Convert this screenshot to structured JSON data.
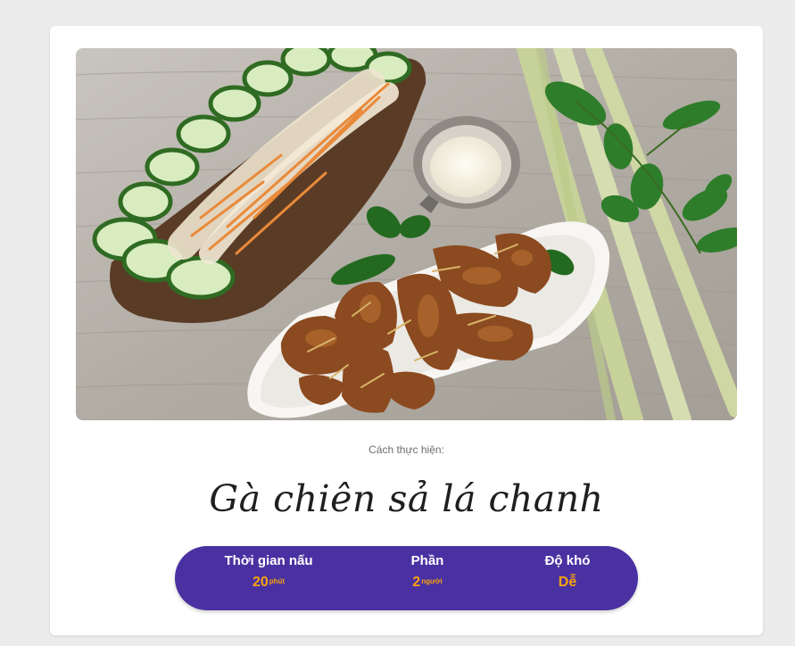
{
  "recipe": {
    "subtitle": "Cách thực hiện:",
    "title": "Gà chiên sả lá chanh",
    "image_alt": "Gà chiên sả lá chanh"
  },
  "stats": {
    "time": {
      "label": "Thời gian nấu",
      "value": "20",
      "unit": "phút"
    },
    "portions": {
      "label": "Phần",
      "value": "2",
      "unit": "người"
    },
    "difficulty": {
      "label": "Độ khó",
      "value": "Dễ"
    }
  },
  "colors": {
    "background": "#ececec",
    "card": "#ffffff",
    "stats_bar": "#4a31a1",
    "accent": "#f8a20e",
    "title": "#1f1f1f"
  }
}
